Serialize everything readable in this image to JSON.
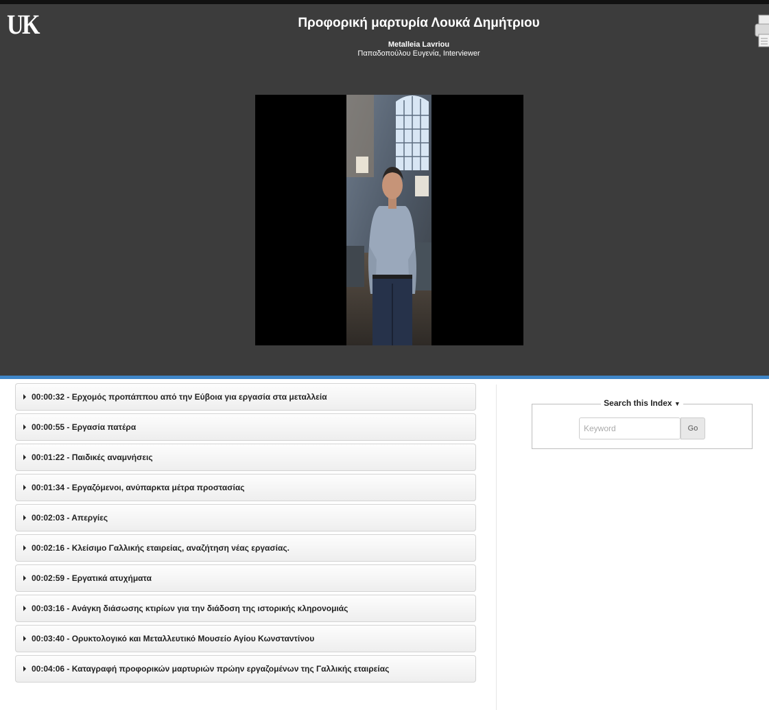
{
  "header": {
    "logo": "UK",
    "title": "Προφορική μαρτυρία Λουκά Δημήτριου",
    "collection": "Metalleia Lavriou",
    "interviewer": "Παπαδοπούλου Ευγενία, Interviewer",
    "print_icon": "printer-icon"
  },
  "video": {
    "content": "photo-of-interviewee-in-museum"
  },
  "index": {
    "items": [
      {
        "label": "00:00:32 - Ερχομός προπάππου από την Εύβοια για εργασία στα μεταλλεία"
      },
      {
        "label": "00:00:55 - Εργασία πατέρα"
      },
      {
        "label": "00:01:22 - Παιδικές αναμνήσεις"
      },
      {
        "label": "00:01:34 - Εργαζόμενοι, ανύπαρκτα μέτρα προστασίας"
      },
      {
        "label": "00:02:03 - Απεργίες"
      },
      {
        "label": "00:02:16 - Κλείσιμο Γαλλικής εταιρείας, αναζήτηση νέας εργασίας."
      },
      {
        "label": "00:02:59 - Εργατικά ατυχήματα"
      },
      {
        "label": "00:03:16 - Ανάγκη διάσωσης κτιρίων για την διάδοση της ιστορικής κληρονομιάς"
      },
      {
        "label": "00:03:40 - Ορυκτολογικό και Μεταλλευτικό Μουσείο Αγίου Κωνσταντίνου"
      },
      {
        "label": "00:04:06 - Καταγραφή προφορικών μαρτυριών πρώην εργαζομένων της Γαλλικής εταιρείας"
      }
    ]
  },
  "search": {
    "legend": "Search this Index",
    "toggle_icon": "caret-down-icon",
    "placeholder": "Keyword",
    "value": "",
    "button_label": "Go"
  },
  "colors": {
    "header_bg": "#3c3c3c",
    "accent_rule": "#3f86c8",
    "item_border": "#d3d3d3"
  }
}
